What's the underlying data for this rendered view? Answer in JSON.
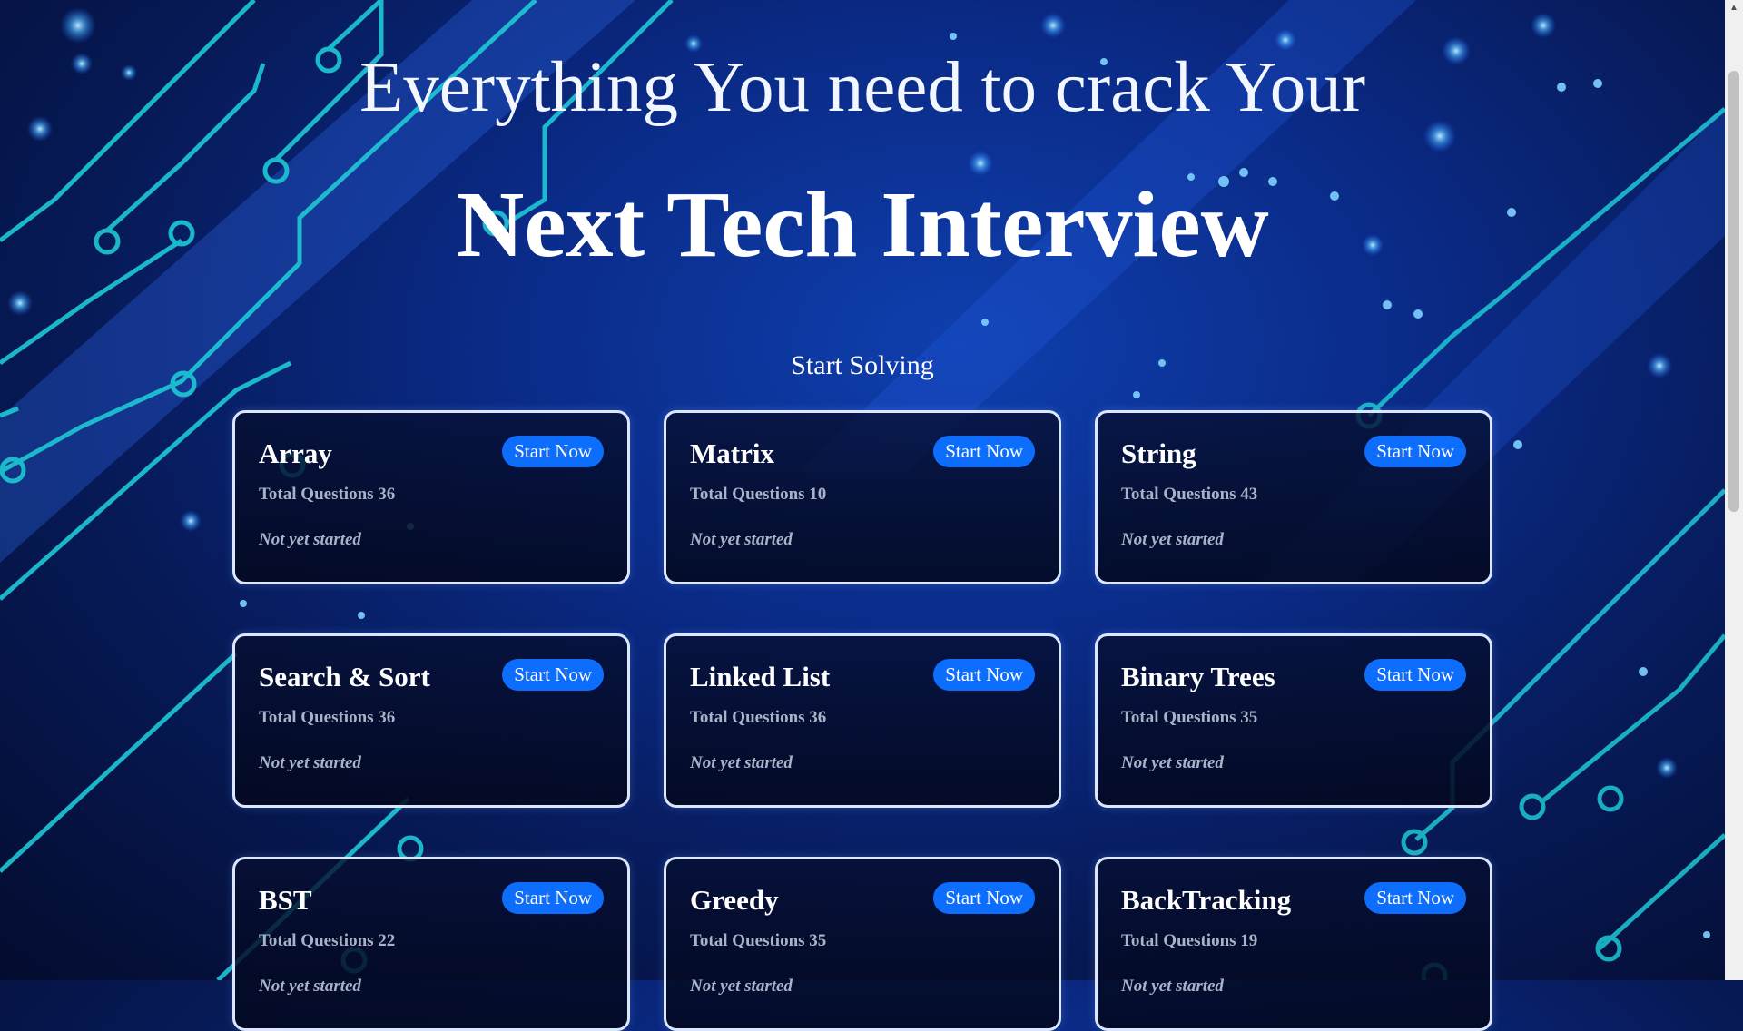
{
  "hero": {
    "line1": "Everything You need to crack Your",
    "line2": "Next Tech Interview"
  },
  "section": {
    "title": "Start Solving"
  },
  "cards": [
    {
      "title": "Array",
      "button": "Start Now",
      "count": "Total Questions 36",
      "status": "Not yet started"
    },
    {
      "title": "Matrix",
      "button": "Start Now",
      "count": "Total Questions 10",
      "status": "Not yet started"
    },
    {
      "title": "String",
      "button": "Start Now",
      "count": "Total Questions 43",
      "status": "Not yet started"
    },
    {
      "title": "Search & Sort",
      "button": "Start Now",
      "count": "Total Questions 36",
      "status": "Not yet started"
    },
    {
      "title": "Linked List",
      "button": "Start Now",
      "count": "Total Questions 36",
      "status": "Not yet started"
    },
    {
      "title": "Binary Trees",
      "button": "Start Now",
      "count": "Total Questions 35",
      "status": "Not yet started"
    },
    {
      "title": "BST",
      "button": "Start Now",
      "count": "Total Questions 22",
      "status": "Not yet started"
    },
    {
      "title": "Greedy",
      "button": "Start Now",
      "count": "Total Questions 35",
      "status": "Not yet started"
    },
    {
      "title": "BackTracking",
      "button": "Start Now",
      "count": "Total Questions 19",
      "status": "Not yet started"
    }
  ],
  "colors": {
    "accent": "#0d6efd",
    "circuit": "#1ec8d6",
    "background": "#0a2a86"
  },
  "icons": {
    "scroll_up": "triangle-up-icon"
  }
}
